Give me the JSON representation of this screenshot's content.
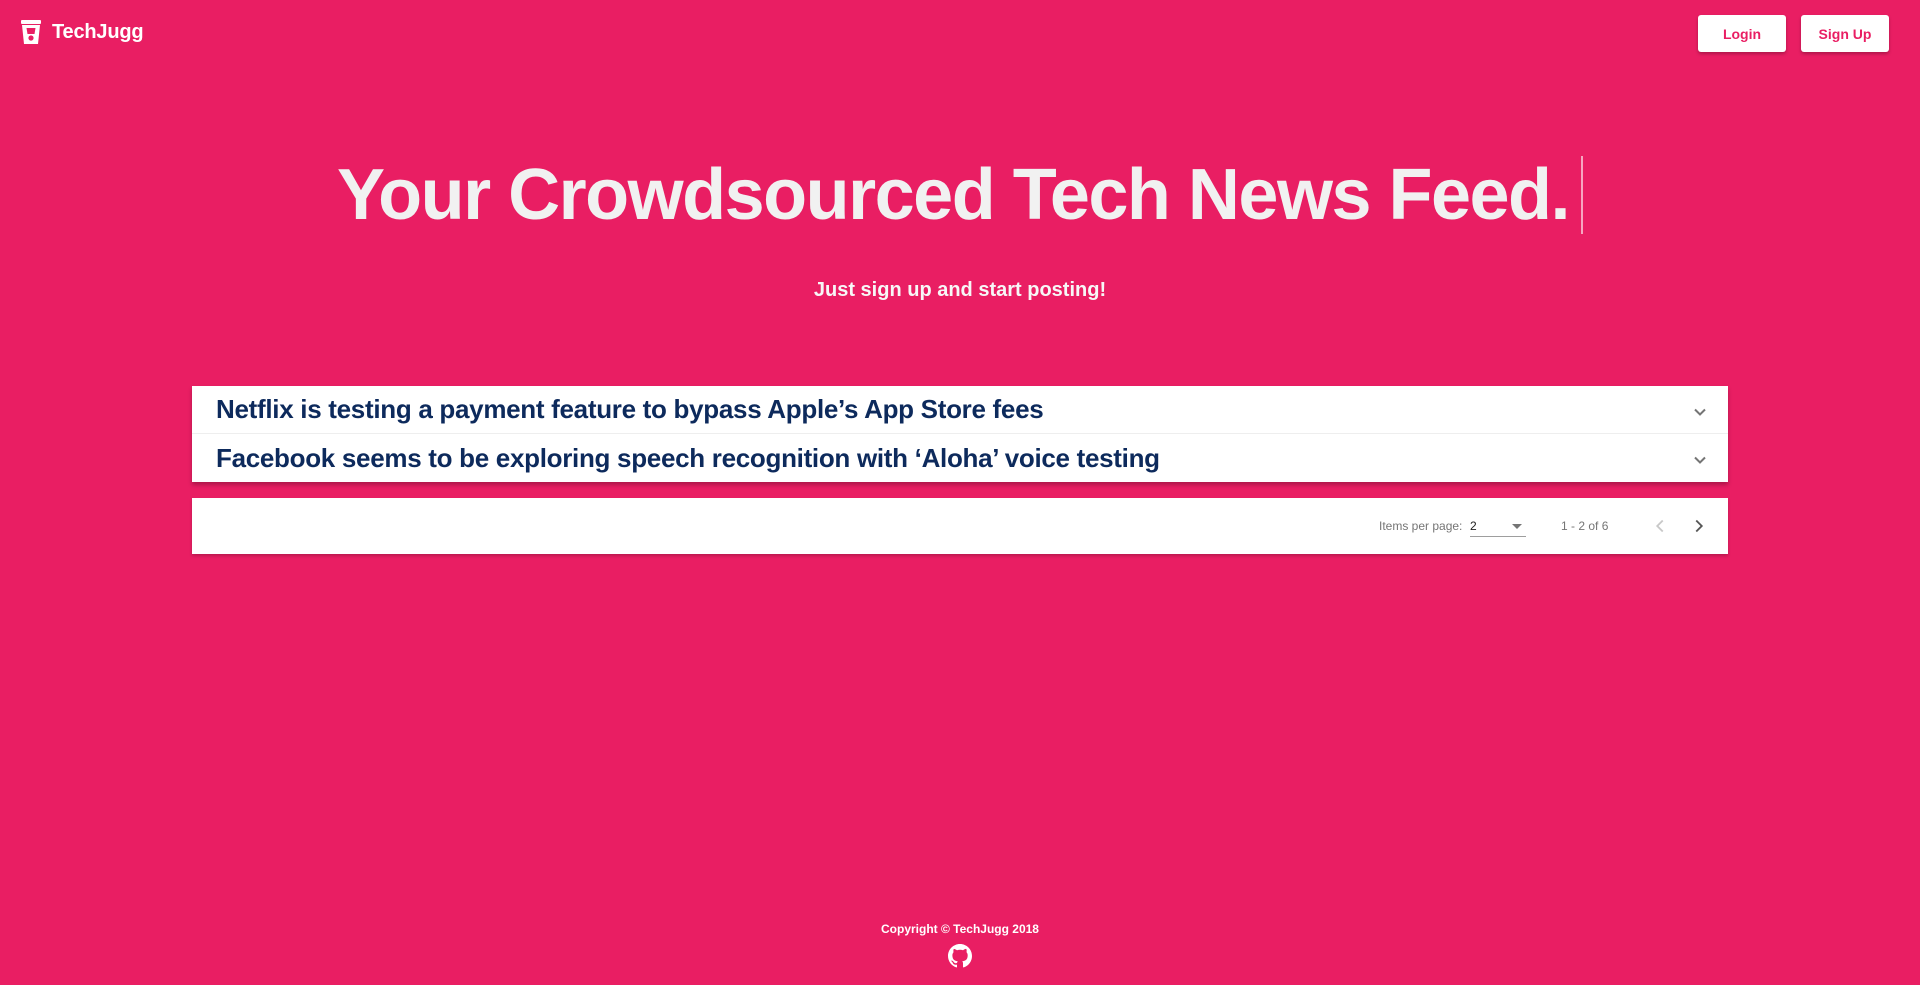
{
  "header": {
    "brand_name": "TechJugg",
    "brand_icon": "cup-icon",
    "login_label": "Login",
    "signup_label": "Sign Up"
  },
  "hero": {
    "title": "Your Crowdsourced Tech News Feed.",
    "subtitle": "Just sign up and start posting!"
  },
  "feed": {
    "items": [
      {
        "title": "Netflix is testing a payment feature to bypass Apple’s App Store fees",
        "icon": "chevron-down-icon"
      },
      {
        "title": "Facebook seems to be exploring speech recognition with ‘Aloha’ voice testing",
        "icon": "chevron-down-icon"
      }
    ]
  },
  "paginator": {
    "items_per_page_label": "Items per page:",
    "items_per_page_value": "2",
    "range_label": "1 - 2 of 6",
    "prev_icon": "chevron-left-icon",
    "next_icon": "chevron-right-icon"
  },
  "footer": {
    "copyright": "Copyright © TechJugg 2018",
    "github_icon": "github-icon"
  },
  "colors": {
    "background": "#e91e63",
    "headline_text": "#0d2a5c",
    "button_text": "#e91e63"
  }
}
